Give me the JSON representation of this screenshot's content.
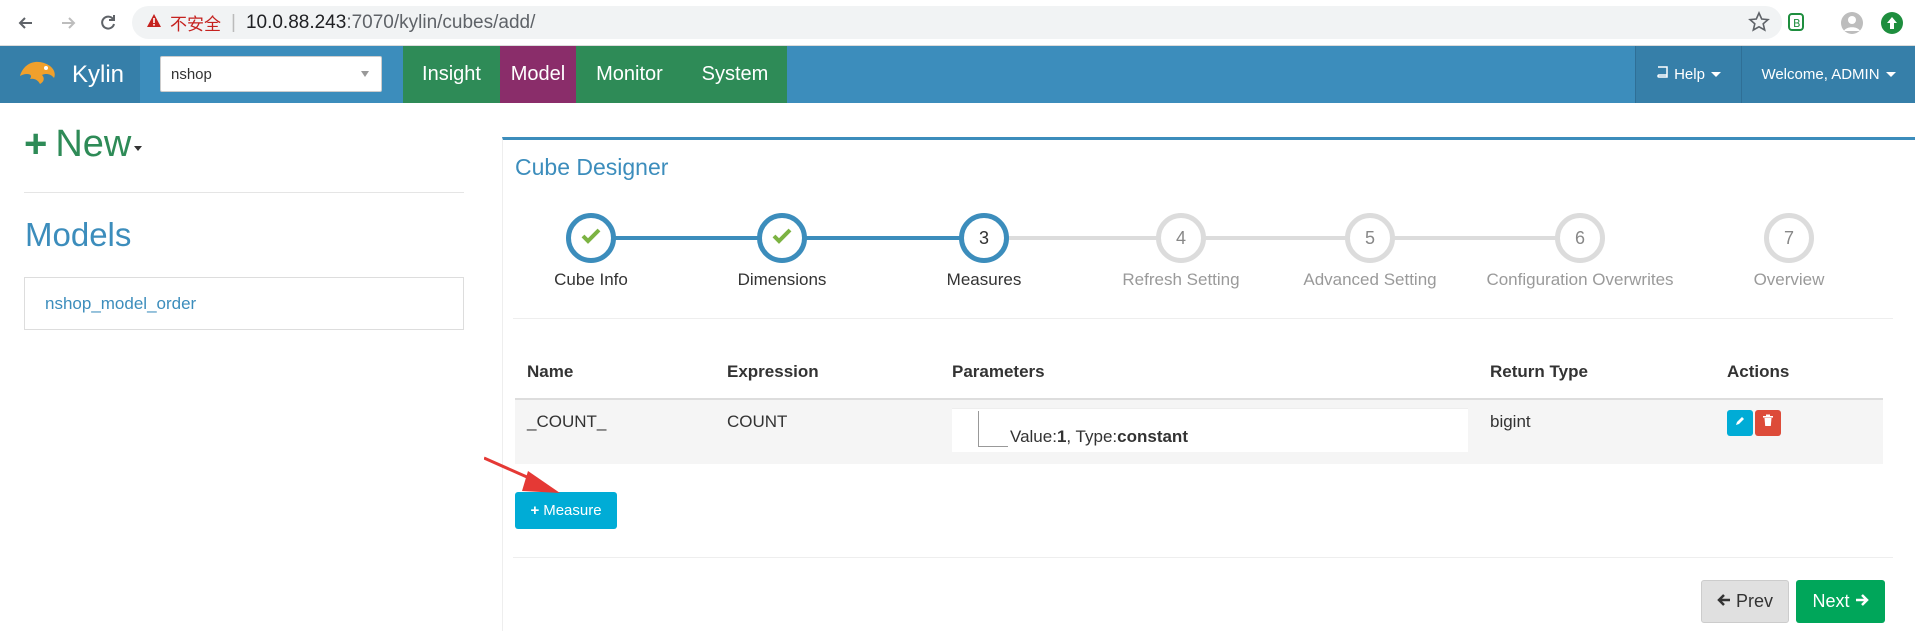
{
  "browser": {
    "security_label": "不安全",
    "url_host": "10.0.88.243",
    "url_path": ":7070/kylin/cubes/add/"
  },
  "navbar": {
    "brand": "Kylin",
    "project": "nshop",
    "tabs": [
      "Insight",
      "Model",
      "Monitor",
      "System"
    ],
    "active_tab": "Model",
    "help": "Help",
    "welcome": "Welcome, ADMIN"
  },
  "left": {
    "new_label": "New",
    "models_title": "Models",
    "models": [
      "nshop_model_order"
    ]
  },
  "designer": {
    "title": "Cube Designer",
    "steps": [
      {
        "num": "1",
        "label": "Cube Info",
        "state": "done"
      },
      {
        "num": "2",
        "label": "Dimensions",
        "state": "done"
      },
      {
        "num": "3",
        "label": "Measures",
        "state": "current"
      },
      {
        "num": "4",
        "label": "Refresh Setting",
        "state": "todo"
      },
      {
        "num": "5",
        "label": "Advanced Setting",
        "state": "todo"
      },
      {
        "num": "6",
        "label": "Configuration Overwrites",
        "state": "todo"
      },
      {
        "num": "7",
        "label": "Overview",
        "state": "todo"
      }
    ],
    "table": {
      "headers": {
        "name": "Name",
        "expression": "Expression",
        "parameters": "Parameters",
        "return_type": "Return Type",
        "actions": "Actions"
      },
      "rows": [
        {
          "name": "_COUNT_",
          "expression": "COUNT",
          "param_value_label": "Value:",
          "param_value": "1",
          "param_type_label": ", Type:",
          "param_type": "constant",
          "return_type": "bigint"
        }
      ]
    },
    "add_measure": "Measure",
    "prev": "Prev",
    "next": "Next"
  },
  "colors": {
    "navbar": "#3c8dbc",
    "tab_green": "#2e8b57",
    "tab_active": "#8a2d6a",
    "accent_blue": "#3c8dbc",
    "info": "#00acd6",
    "danger": "#dd4b39",
    "success": "#00a65a"
  }
}
